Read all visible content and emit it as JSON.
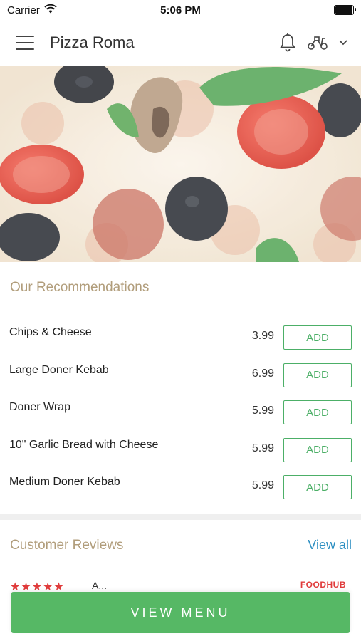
{
  "status_bar": {
    "carrier": "Carrier",
    "time": "5:06 PM"
  },
  "header": {
    "title": "Pizza Roma"
  },
  "hero": {
    "alt": "Pizza with olives, tomatoes, mushrooms and basil"
  },
  "recommendations": {
    "title": "Our Recommendations",
    "items": [
      {
        "name": "Chips & Cheese",
        "price": "3.99",
        "button": "ADD"
      },
      {
        "name": "Large Doner Kebab",
        "price": "6.99",
        "button": "ADD"
      },
      {
        "name": "Doner Wrap",
        "price": "5.99",
        "button": "ADD"
      },
      {
        "name": "10\" Garlic Bread with Cheese",
        "price": "5.99",
        "button": "ADD"
      },
      {
        "name": "Medium Doner Kebab",
        "price": "5.99",
        "button": "ADD"
      }
    ]
  },
  "reviews": {
    "title": "Customer Reviews",
    "view_all": "View all",
    "first_review": {
      "stars": "★★★★★",
      "reviewer": "A...",
      "source": "FOODHUB"
    }
  },
  "cta": {
    "label": "VIEW MENU"
  },
  "colors": {
    "accent_green": "#56b865",
    "section_title": "#b19d7b",
    "link_blue": "#2d8fc2",
    "star_red": "#e03b3b"
  }
}
